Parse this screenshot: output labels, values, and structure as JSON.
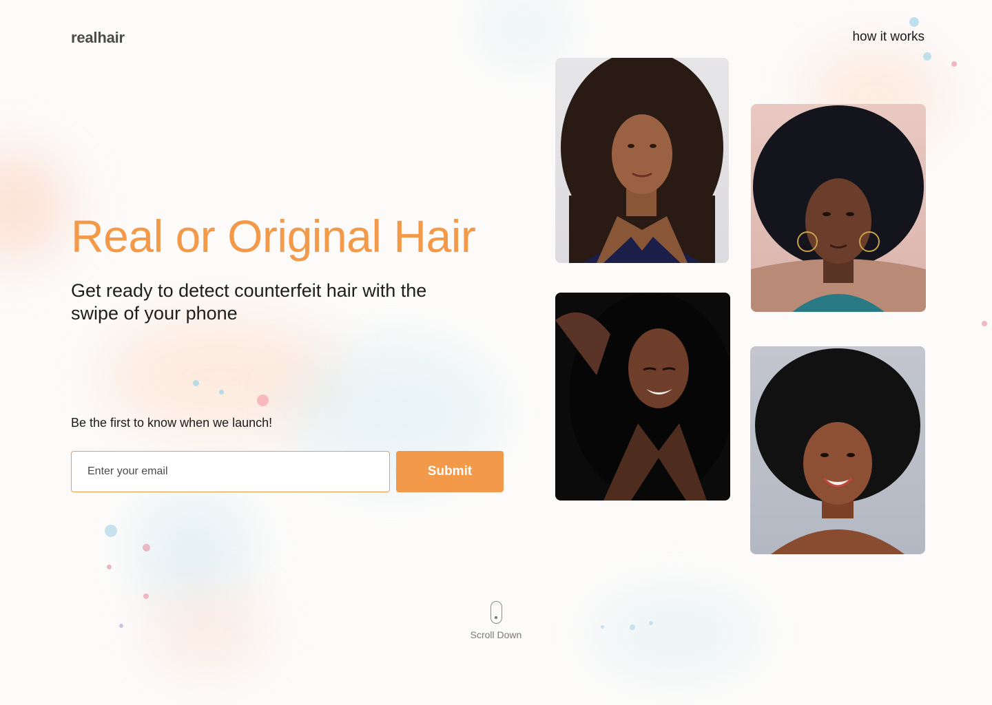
{
  "header": {
    "logo": "realhair",
    "nav_link": "how it works"
  },
  "hero": {
    "title": "Real or Original Hair",
    "subtitle": "Get ready to detect counterfeit hair with the swipe of your phone"
  },
  "signup": {
    "prompt": "Be the first to know when we launch!",
    "email_placeholder": "Enter your email",
    "submit_label": "Submit"
  },
  "scroll": {
    "label": "Scroll Down"
  },
  "colors": {
    "accent": "#f2994a",
    "background": "#fcfbfa",
    "text": "#1d1d1d"
  }
}
